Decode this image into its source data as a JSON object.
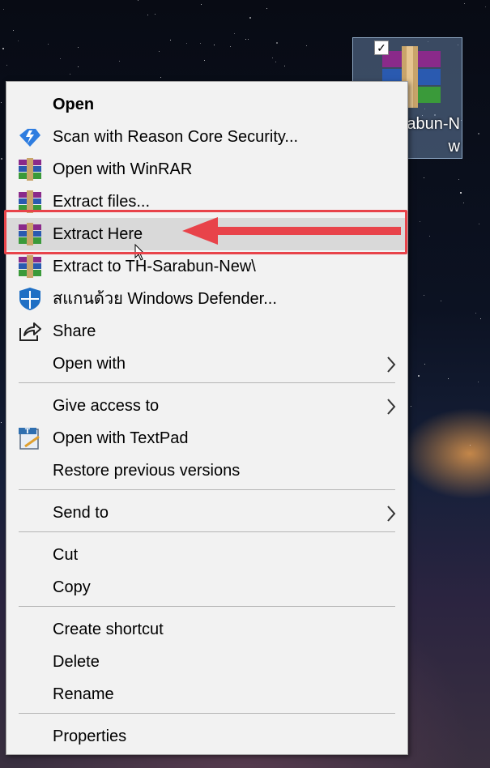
{
  "desktop_icon": {
    "label": "abun-N\nw",
    "checked": true
  },
  "menu": {
    "items": [
      {
        "id": "open",
        "label": "Open",
        "bold": true,
        "icon": "none"
      },
      {
        "id": "scan",
        "label": "Scan with Reason Core Security...",
        "icon": "reason-core-icon"
      },
      {
        "id": "open-winrar",
        "label": "Open with WinRAR",
        "icon": "winrar-icon"
      },
      {
        "id": "extract-files",
        "label": "Extract files...",
        "icon": "winrar-icon"
      },
      {
        "id": "extract-here",
        "label": "Extract Here",
        "icon": "winrar-icon",
        "highlighted": true
      },
      {
        "id": "extract-to",
        "label": "Extract to TH-Sarabun-New\\",
        "icon": "winrar-icon"
      },
      {
        "id": "defender",
        "label": "สแกนด้วย Windows Defender...",
        "icon": "windows-defender-icon"
      },
      {
        "id": "share",
        "label": "Share",
        "icon": "share-icon"
      },
      {
        "id": "open-with",
        "label": "Open with",
        "submenu": true
      },
      {
        "id": "give-access",
        "label": "Give access to",
        "submenu": true
      },
      {
        "id": "textpad",
        "label": "Open with TextPad",
        "icon": "textpad-icon"
      },
      {
        "id": "restore",
        "label": "Restore previous versions"
      },
      {
        "id": "send-to",
        "label": "Send to",
        "submenu": true
      },
      {
        "id": "cut",
        "label": "Cut"
      },
      {
        "id": "copy",
        "label": "Copy"
      },
      {
        "id": "create-shortcut",
        "label": "Create shortcut"
      },
      {
        "id": "delete",
        "label": "Delete"
      },
      {
        "id": "rename",
        "label": "Rename"
      },
      {
        "id": "properties",
        "label": "Properties"
      }
    ],
    "submenu_glyph": "›"
  },
  "colors": {
    "menu_bg": "#f2f2f2",
    "hover_bg": "#d9d9d9",
    "annotation_red": "#e8434a"
  }
}
